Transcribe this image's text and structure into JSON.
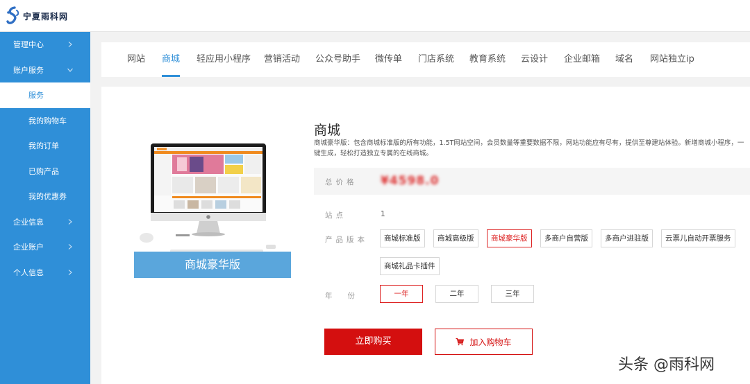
{
  "header": {
    "logo_text": "宁夏雨科网"
  },
  "sidebar": {
    "items": [
      {
        "label": "管理中心"
      },
      {
        "label": "账户服务"
      },
      {
        "label": "服务"
      },
      {
        "label": "我的购物车"
      },
      {
        "label": "我的订单"
      },
      {
        "label": "已购产品"
      },
      {
        "label": "我的优惠券"
      },
      {
        "label": "企业信息"
      },
      {
        "label": "企业账户"
      },
      {
        "label": "个人信息"
      }
    ]
  },
  "tabs": [
    {
      "label": "网站"
    },
    {
      "label": "商城"
    },
    {
      "label": "轻应用小程序"
    },
    {
      "label": "营销活动"
    },
    {
      "label": "公众号助手"
    },
    {
      "label": "微传单"
    },
    {
      "label": "门店系统"
    },
    {
      "label": "教育系统"
    },
    {
      "label": "云设计"
    },
    {
      "label": "企业邮箱"
    },
    {
      "label": "域名"
    },
    {
      "label": "网站独立ip"
    }
  ],
  "product": {
    "banner": "商城豪华版",
    "title": "商城",
    "description": "商城豪华版：包含商城标准版的所有功能，1.5T网站空间，会员数量等重要数据不限，网站功能应有尽有，提供至尊建站体验。新增商城小程序，一键生成，轻松打造独立专属的在线商城。",
    "price_label": "总价格",
    "price_value": "¥4598.0",
    "sites_label": "站点",
    "sites_value": "1",
    "version_label": "产品版本",
    "versions": [
      {
        "label": "商城标准版"
      },
      {
        "label": "商城高级版"
      },
      {
        "label": "商城豪华版"
      },
      {
        "label": "多商户自营版"
      },
      {
        "label": "多商户进驻版"
      },
      {
        "label": "云票儿自动开票服务"
      },
      {
        "label": "商城礼品卡插件"
      }
    ],
    "selected_version": "商城豪华版",
    "years_label": "年份",
    "years": [
      {
        "label": "一年"
      },
      {
        "label": "二年"
      },
      {
        "label": "三年"
      }
    ],
    "selected_year": "一年",
    "buy_label": "立即购买",
    "cart_label": "加入购物车"
  },
  "watermark": "头条 @雨科网",
  "colors": {
    "accent": "#2f8fd8",
    "buy": "#d40f0f"
  }
}
